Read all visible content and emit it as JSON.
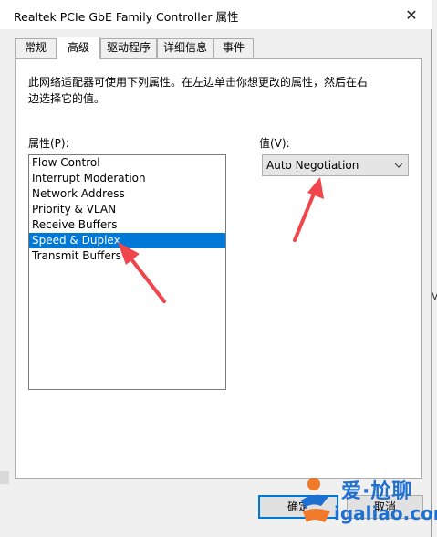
{
  "window": {
    "title": "Realtek PCIe GbE Family Controller 属性",
    "close_glyph": "✕"
  },
  "tabs": [
    {
      "label": "常规",
      "active": false
    },
    {
      "label": "高级",
      "active": true
    },
    {
      "label": "驱动程序",
      "active": false
    },
    {
      "label": "详细信息",
      "active": false
    },
    {
      "label": "事件",
      "active": false
    }
  ],
  "panel": {
    "description": "此网络适配器可使用下列属性。在左边单击你想更改的属性，然后在右\n边选择它的值。",
    "property_label": "属性(P):",
    "value_label": "值(V):",
    "properties": [
      "Flow Control",
      "Interrupt Moderation",
      "Network Address",
      "Priority & VLAN",
      "Receive Buffers",
      "Speed & Duplex",
      "Transmit Buffers"
    ],
    "selected_index": 5,
    "selected_value": "Auto Negotiation"
  },
  "buttons": {
    "ok": "确定",
    "cancel": "取消"
  },
  "background": {
    "side_text": "Va"
  },
  "watermark": {
    "brand_top": "爱·尬聊",
    "brand_bottom": "igaliao.com"
  },
  "colors": {
    "selection": "#0078d7",
    "annotation_arrow": "#f0464b",
    "watermark": "#1e6fd0"
  }
}
